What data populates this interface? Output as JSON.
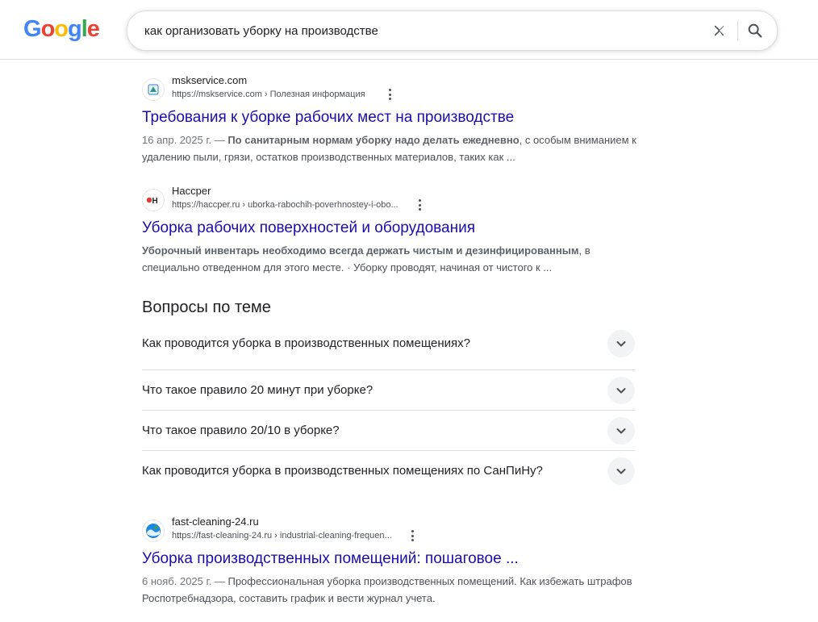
{
  "header": {
    "logo_letters": [
      "G",
      "o",
      "o",
      "g",
      "l",
      "e"
    ],
    "logo_colors": [
      "#4285F4",
      "#EA4335",
      "#FBBC05",
      "#4285F4",
      "#34A853",
      "#EA4335"
    ],
    "search_value": "как организовать уборку на производстве",
    "clear_icon": "close-icon",
    "search_icon": "search-icon"
  },
  "results": [
    {
      "site_name": "mskservice.com",
      "url": "https://mskservice.com › Полезная информация",
      "title": "Требования к уборке рабочих мест на производстве",
      "snippet_date": "16 апр. 2025 г. — ",
      "snippet_bold": "По санитарным нормам уборку надо делать ежедневно",
      "snippet_rest": ", с особым вниманием к удалению пыли, грязи, остатков производственных материалов, таких как ..."
    },
    {
      "site_name": "Haccper",
      "url": "https://haccper.ru › uborka-rabochih-poverhnostey-i-obo...",
      "title": "Уборка рабочих поверхностей и оборудования",
      "snippet_date": "",
      "snippet_bold": "Уборочный инвентарь необходимо всегда держать чистым и дезинфицированным",
      "snippet_rest": ", в специально отведенном для этого месте. · Уборку проводят, начиная от чистого к ..."
    },
    {
      "site_name": "fast-cleaning-24.ru",
      "url": "https://fast-cleaning-24.ru › industrial-cleaning-frequen...",
      "title": "Уборка производственных помещений: пошаговое ...",
      "snippet_date": "6 нояб. 2025 г. — ",
      "snippet_bold": "",
      "snippet_rest": "Профессиональная уборка производственных помещений. Как избежать штрафов Роспотребнадзора, составить график и вести журнал учета."
    }
  ],
  "paa": {
    "title": "Вопросы по теме",
    "questions": [
      "Как проводится уборка в производственных помещениях?",
      "Что такое правило 20 минут при уборке?",
      "Что такое правило 20/10 в уборке?",
      "Как проводится уборка в производственных помещениях по СанПиНу?"
    ]
  }
}
